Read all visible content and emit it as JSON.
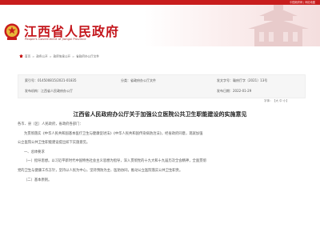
{
  "topbar": {
    "right_text": "中国政府网 | 网站地图"
  },
  "header": {
    "title": "江西省人民政府",
    "subtitle": "People's Government of Jiangxi Province",
    "brand_color": "#c4161c"
  },
  "breadcrumb": {
    "items": [
      "首页",
      "政务公开",
      "政府信息公开",
      "省政府办公厅文件"
    ]
  },
  "meta": {
    "index_label": "索引号：",
    "index_value": "014500815/2021-01835",
    "category_label": "分类：",
    "category_value": "省政府办公厅文件",
    "docno_label": "发文字号：",
    "docno_value": "赣府厅字〔2021〕13号",
    "issuer_label": "发布机构：",
    "issuer_value": "江西省人民政府办公厅",
    "date_label": "发布日期：",
    "date_value": "2022-01-29",
    "font_ctl": "字体：【大 中 小】"
  },
  "article": {
    "title": "江西省人民政府办公厅关于加强公立医院公共卫生职能建设的实施意见",
    "salutation": "各市、县（区）人民政府，省政府各部门：",
    "paragraphs": [
      "为贯彻落实《中华人民共和国基本医疗卫生与健康促进法》《中华人民共和国传染病防治法》，经省政府同意，现就加强",
      "公立医院公共卫生职能建设提出如下实施意见。",
      "一、总体要求",
      "（一）指导思想。以习近平新时代中国特色社会主义思想为指导，深入贯彻党的十九大和十九届历次全会精神，全面贯彻",
      "党的卫生与健康工作方针，坚持以人民为中心，坚持预防为主、医防协同，推动公立医院落实公共卫生职责。",
      "（二）基本原则。"
    ]
  }
}
